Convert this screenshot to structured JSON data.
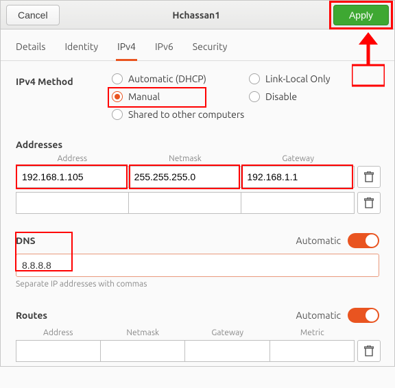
{
  "header": {
    "cancel": "Cancel",
    "title": "Hchassan1",
    "apply": "Apply"
  },
  "tabs": {
    "details": "Details",
    "identity": "Identity",
    "ipv4": "IPv4",
    "ipv6": "IPv6",
    "security": "Security"
  },
  "ipv4_method": {
    "label": "IPv4 Method",
    "options": {
      "auto": "Automatic (DHCP)",
      "link_local": "Link-Local Only",
      "manual": "Manual",
      "disable": "Disable",
      "shared": "Shared to other computers"
    }
  },
  "addresses": {
    "title": "Addresses",
    "cols": {
      "address": "Address",
      "netmask": "Netmask",
      "gateway": "Gateway"
    },
    "rows": [
      {
        "address": "192.168.1.105",
        "netmask": "255.255.255.0",
        "gateway": "192.168.1.1"
      },
      {
        "address": "",
        "netmask": "",
        "gateway": ""
      }
    ]
  },
  "dns": {
    "title": "DNS",
    "auto_label": "Automatic",
    "value": "8.8.8.8",
    "helper": "Separate IP addresses with commas"
  },
  "routes": {
    "title": "Routes",
    "auto_label": "Automatic",
    "cols": {
      "address": "Address",
      "netmask": "Netmask",
      "gateway": "Gateway",
      "metric": "Metric"
    },
    "rows": [
      {
        "address": "",
        "netmask": "",
        "gateway": "",
        "metric": ""
      }
    ]
  }
}
